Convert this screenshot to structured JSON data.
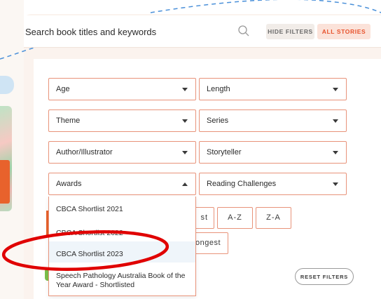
{
  "search": {
    "placeholder": "Search book titles and keywords",
    "hide_filters_label": "HIDE FILTERS",
    "all_stories_label": "ALL STORIES"
  },
  "filters": {
    "age": "Age",
    "length": "Length",
    "theme": "Theme",
    "series": "Series",
    "author": "Author/Illustrator",
    "storyteller": "Storyteller",
    "awards": "Awards",
    "reading_challenges": "Reading Challenges"
  },
  "awards_dropdown": {
    "options": [
      "CBCA Shortlist 2021",
      "CBCA Shortlist 2022",
      "CBCA Shortlist 2023",
      "Speech Pathology Australia Book of the Year Award - Shortlisted"
    ],
    "highlighted_index": 2
  },
  "sort": {
    "shortest_fragment": "st",
    "az": "A-Z",
    "za": "Z-A",
    "longest_fragment": "ongest"
  },
  "reset_label": "RESET FILTERS",
  "colors": {
    "accent": "#e8522c",
    "border": "#e8937a",
    "annotation": "#e00000",
    "highlight": "#eff5fa"
  }
}
